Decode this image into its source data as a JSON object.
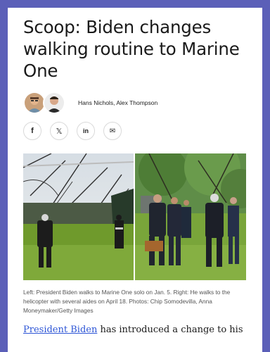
{
  "article": {
    "headline": "Scoop: Biden changes walking routine to Marine One",
    "authors": "Hans Nichols, Alex Thompson",
    "share": {
      "facebook_icon": "f",
      "x_icon": "𝕏",
      "linkedin_icon": "in",
      "email_icon": "✉"
    },
    "caption": "Left: President Biden walks to Marine One solo on Jan. 5. Right: He walks to the helicopter with several aides on April 18. Photos: Chip Somodevilla, Anna Moneymaker/Getty Images",
    "body_link": "President Biden",
    "body_rest": " has introduced a change to his"
  },
  "colors": {
    "frame": "#5b5fb8",
    "link": "#2e56d6"
  }
}
